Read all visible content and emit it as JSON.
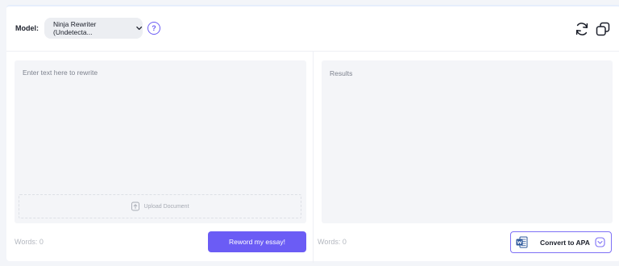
{
  "toolbar": {
    "model_label": "Model:",
    "model_value": "Ninja Rewriter (Undetecta...",
    "help_symbol": "?",
    "icons": [
      "refresh-icon",
      "copy-icon"
    ]
  },
  "editor": {
    "input_placeholder": "Enter text here to rewrite",
    "upload_label": "Upload Document",
    "results_label": "Results"
  },
  "footer": {
    "words_left": "Words: 0",
    "words_right": "Words: 0",
    "reword_label": "Reword my essay!",
    "apa_label": "Convert to APA"
  },
  "colors": {
    "accent": "#6b5cf5",
    "panel_bg": "#f4f5f8",
    "word_blue": "#2b579a"
  }
}
